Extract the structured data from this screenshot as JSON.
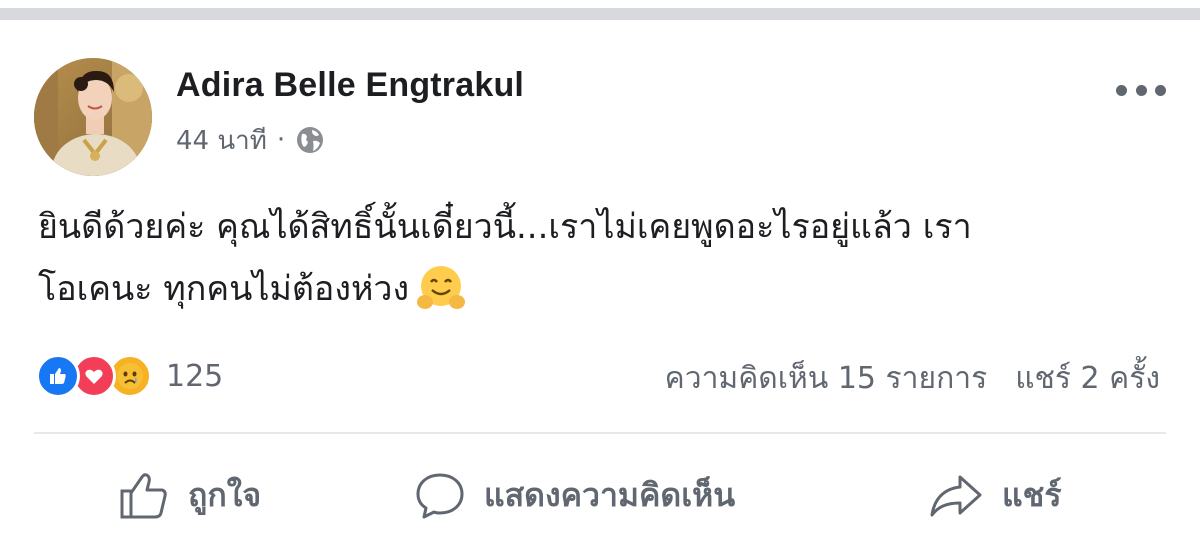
{
  "post": {
    "author": "Adira Belle Engtrakul",
    "time": "44 นาที",
    "separator": "·",
    "privacy_icon": "globe-icon",
    "more_icon": "more-options-icon",
    "text_line1": "ยินดีด้วยค่ะ คุณได้สิทธิ์นั้นเดี๋ยวนี้...เราไม่เคยพูดอะไรอยู่แล้ว  เรา",
    "text_line2": "โอเคนะ ทุกคนไม่ต้องห่วง",
    "emoji": "hugging-face-emoji"
  },
  "reactions": {
    "icons": [
      "like-reaction-icon",
      "love-reaction-icon",
      "sad-reaction-icon"
    ],
    "count": "125"
  },
  "stats": {
    "comments": "ความคิดเห็น 15 รายการ",
    "shares": "แชร์ 2 ครั้ง"
  },
  "actions": {
    "like": "ถูกใจ",
    "comment": "แสดงความคิดเห็น",
    "share": "แชร์"
  },
  "colors": {
    "like_blue": "#1877f2",
    "love_red": "#f33e58",
    "sad_yellow": "#f7b125",
    "secondary_text": "#606770",
    "divider": "#d7d9dd"
  }
}
